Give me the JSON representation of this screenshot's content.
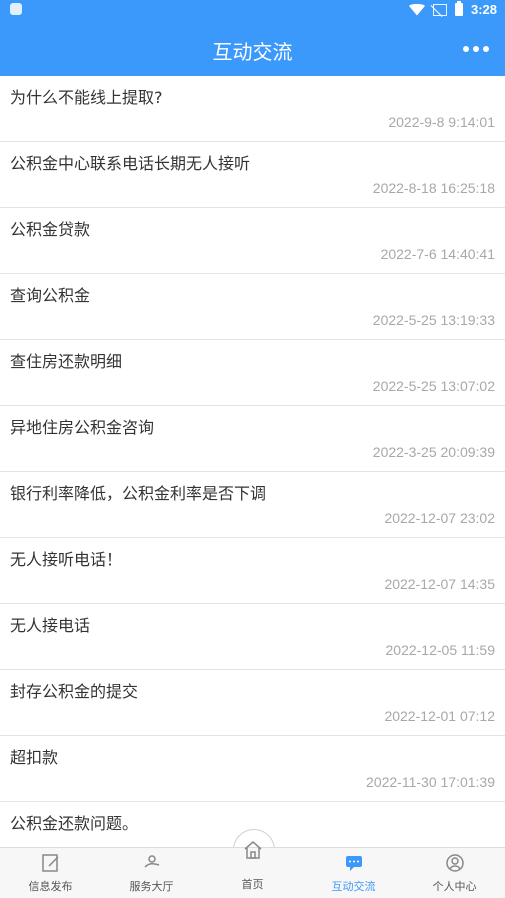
{
  "status_bar": {
    "time": "3:28"
  },
  "app_bar": {
    "title": "互动交流"
  },
  "items": [
    {
      "title": "为什么不能线上提取?",
      "date": "2022-9-8 9:14:01"
    },
    {
      "title": "公积金中心联系电话长期无人接听",
      "date": "2022-8-18 16:25:18"
    },
    {
      "title": "公积金贷款",
      "date": "2022-7-6 14:40:41"
    },
    {
      "title": "查询公积金",
      "date": "2022-5-25 13:19:33"
    },
    {
      "title": "查住房还款明细",
      "date": "2022-5-25 13:07:02"
    },
    {
      "title": "异地住房公积金咨询",
      "date": "2022-3-25 20:09:39"
    },
    {
      "title": "银行利率降低，公积金利率是否下调",
      "date": "2022-12-07 23:02"
    },
    {
      "title": "无人接听电话！",
      "date": "2022-12-07 14:35"
    },
    {
      "title": "无人接电话",
      "date": "2022-12-05 11:59"
    },
    {
      "title": "封存公积金的提交",
      "date": "2022-12-01 07:12"
    },
    {
      "title": "超扣款",
      "date": "2022-11-30 17:01:39"
    },
    {
      "title": "公积金还款问题。",
      "date": ""
    }
  ],
  "tabs": [
    {
      "label": "信息发布",
      "icon": "edit-icon"
    },
    {
      "label": "服务大厅",
      "icon": "hand-icon"
    },
    {
      "label": "首页",
      "icon": "home-icon"
    },
    {
      "label": "互动交流",
      "icon": "chat-icon",
      "active": true
    },
    {
      "label": "个人中心",
      "icon": "user-icon"
    }
  ],
  "colors": {
    "primary": "#3b99fc"
  }
}
